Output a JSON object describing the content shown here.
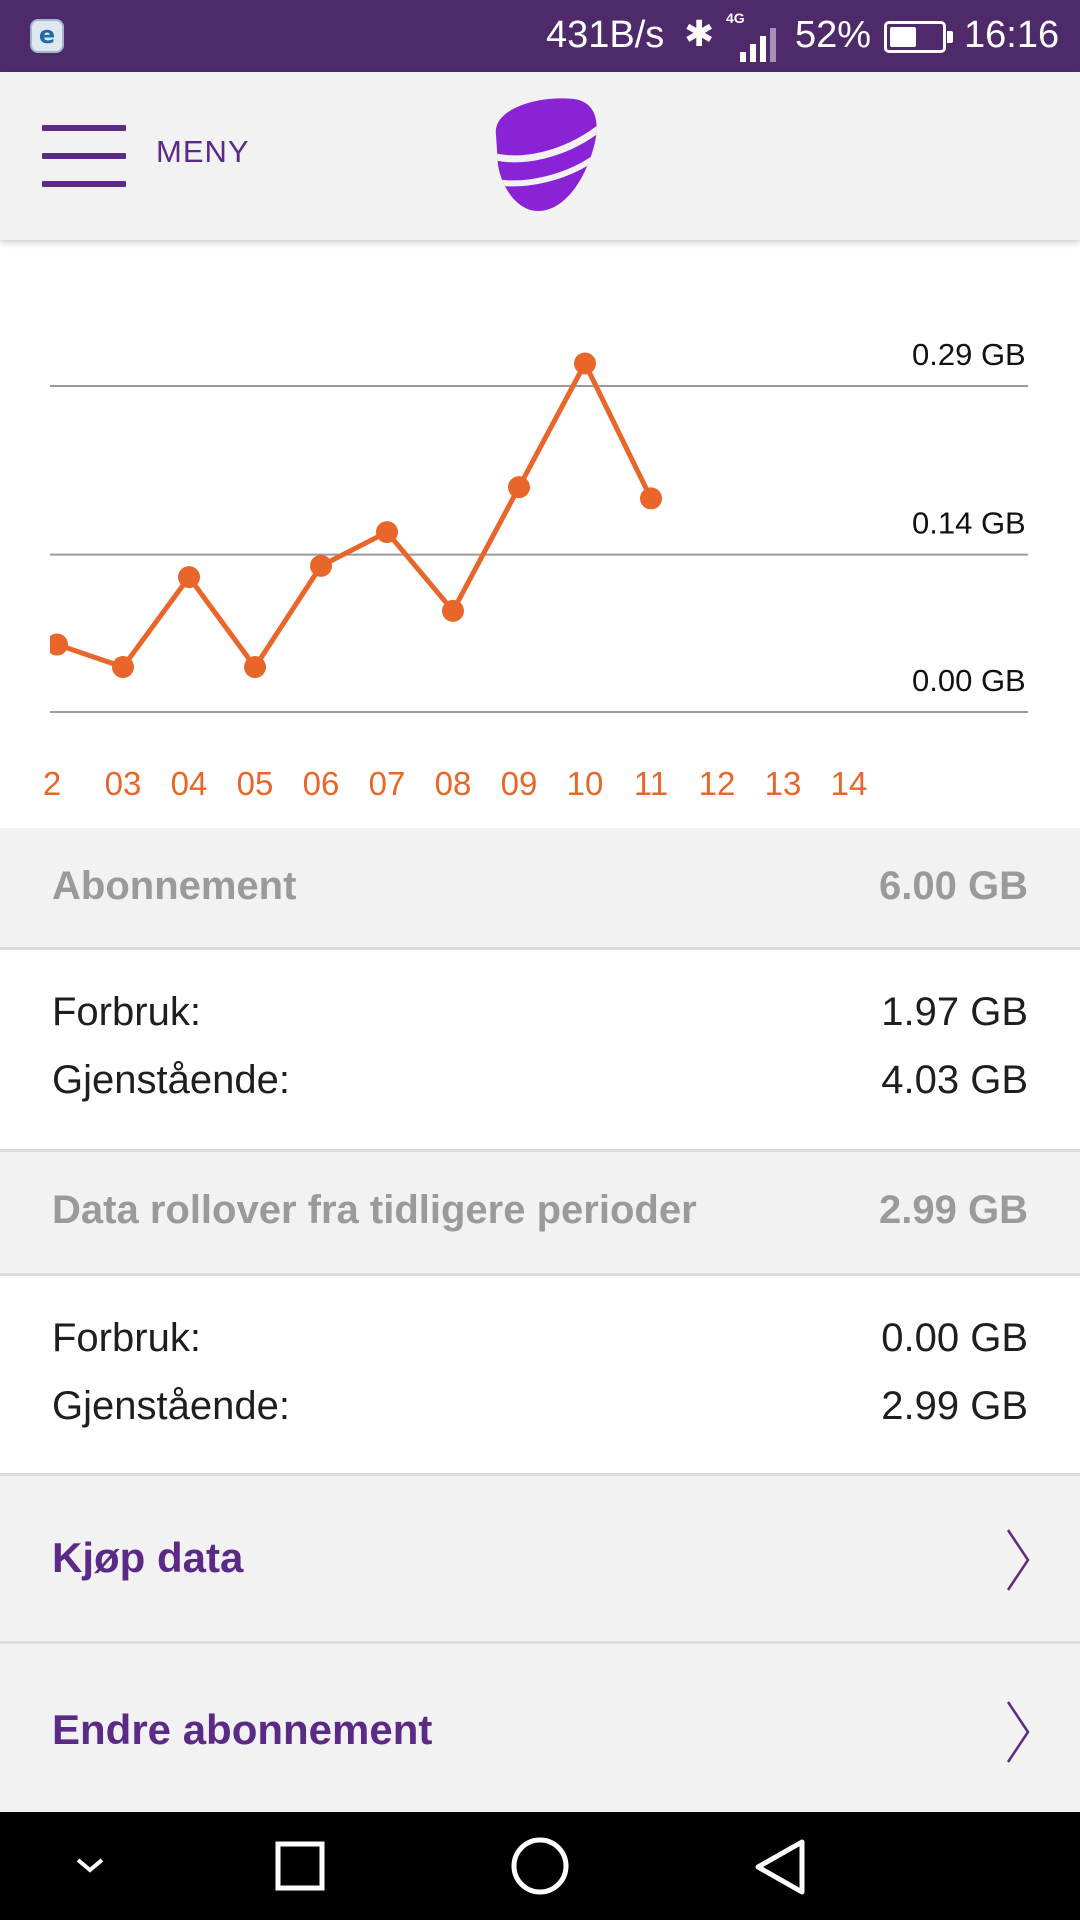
{
  "status_bar": {
    "app_icon": "e-icon",
    "app_icon_letter": "e",
    "network_speed": "431B/s",
    "network_type": "4G",
    "battery_percent": "52%",
    "battery_level": 0.52,
    "time": "16:16"
  },
  "header": {
    "menu_label": "MENY",
    "logo": "telia-logo"
  },
  "chart_data": {
    "type": "line",
    "color": "#e8662a",
    "x_labels": [
      "2",
      "03",
      "04",
      "05",
      "06",
      "07",
      "08",
      "09",
      "10",
      "11",
      "12",
      "13",
      "14"
    ],
    "y_tick_labels": [
      "0.29 GB",
      "0.14 GB",
      "0.00 GB"
    ],
    "y_ticks": [
      0.29,
      0.14,
      0.0
    ],
    "ylim": [
      0,
      0.29
    ],
    "grid": true,
    "series": [
      {
        "x": [
          "2",
          "03",
          "04",
          "05",
          "06",
          "07",
          "08",
          "09",
          "10",
          "11"
        ],
        "values": [
          0.06,
          0.04,
          0.12,
          0.04,
          0.13,
          0.16,
          0.09,
          0.2,
          0.31,
          0.19
        ]
      }
    ]
  },
  "subscription": {
    "label": "Abonnement",
    "total": "6.00 GB",
    "used_label": "Forbruk:",
    "used": "1.97 GB",
    "remaining_label": "Gjenstående:",
    "remaining": "4.03 GB"
  },
  "rollover": {
    "label": "Data rollover fra tidligere perioder",
    "total": "2.99 GB",
    "used_label": "Forbruk:",
    "used": "0.00 GB",
    "remaining_label": "Gjenstående:",
    "remaining": "2.99 GB"
  },
  "actions": {
    "buy_data": "Kjøp data",
    "change_subscription": "Endre abonnement"
  },
  "colors": {
    "status_bar": "#4f2a6b",
    "brand_purple": "#5a2a86",
    "logo_purple": "#8a22d6",
    "chart_line": "#e8662a"
  },
  "nav_bar": {
    "items": [
      "chevron-down-icon",
      "recent-apps-icon",
      "home-icon",
      "back-icon"
    ]
  }
}
